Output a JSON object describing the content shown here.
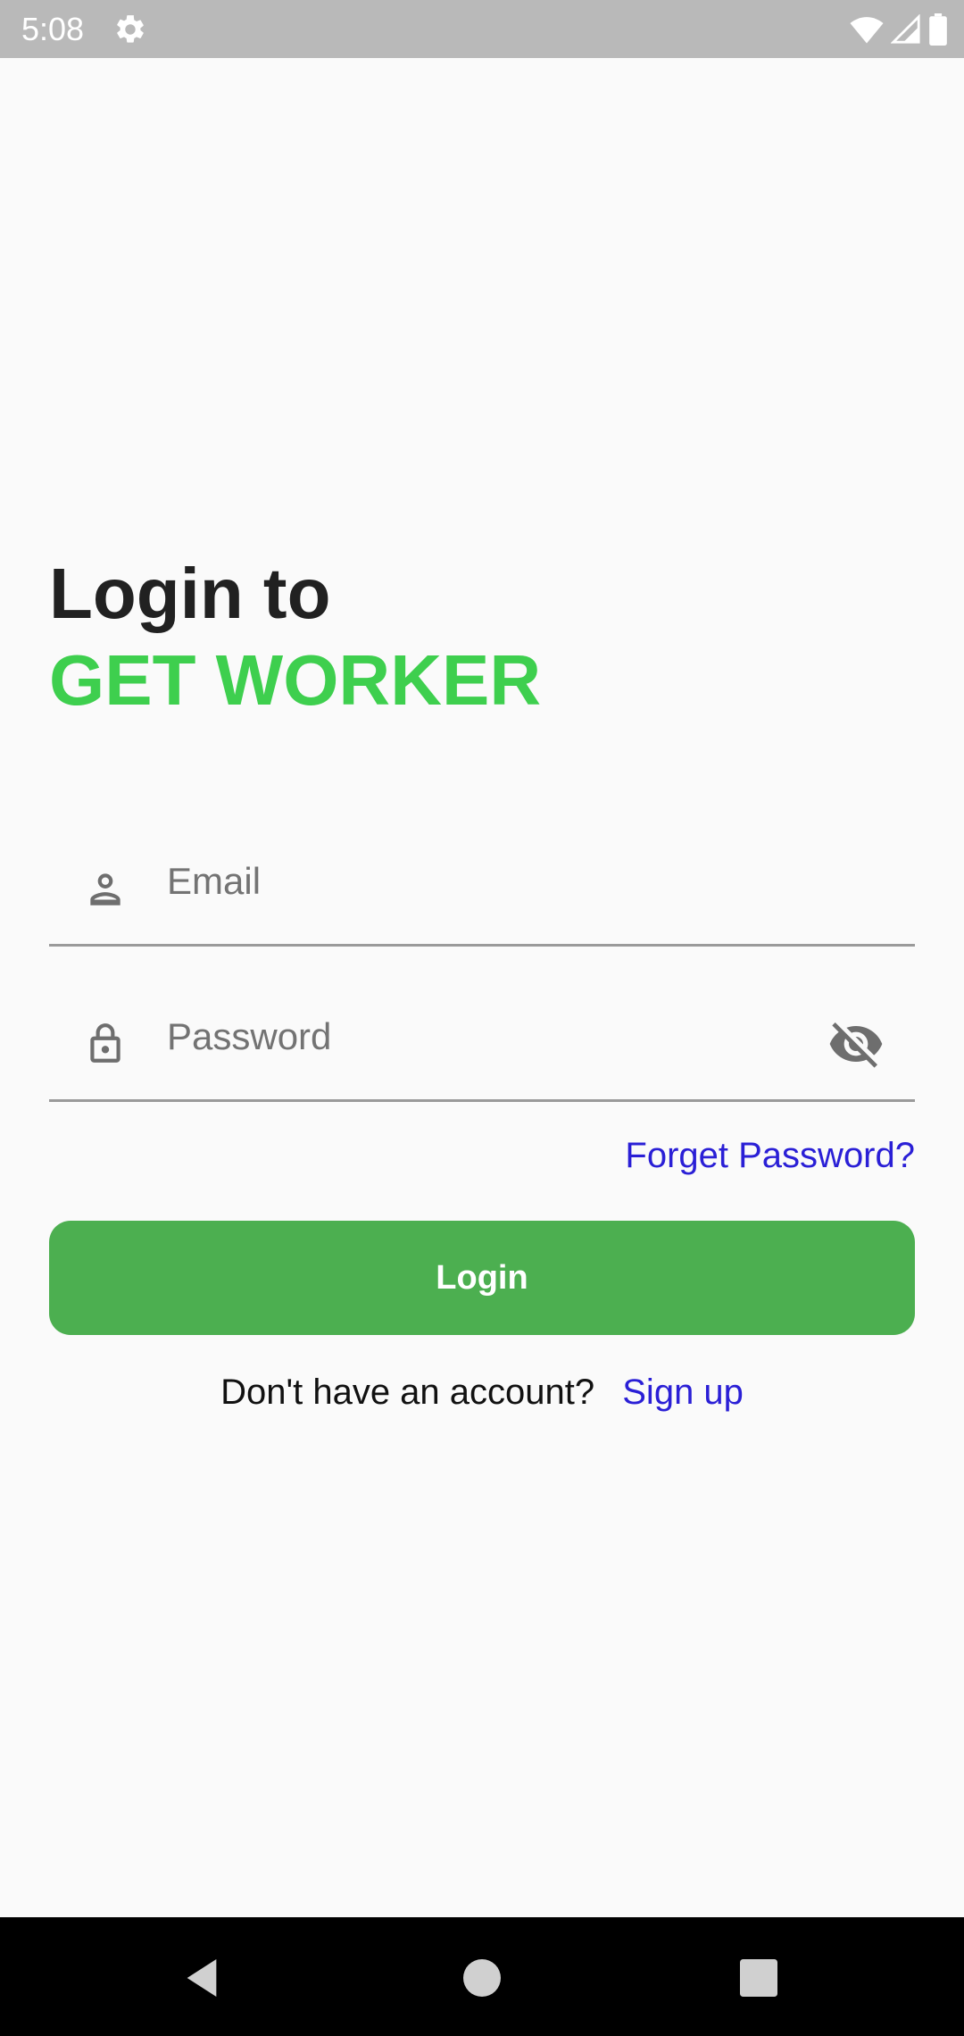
{
  "status_bar": {
    "time": "5:08",
    "icons": [
      "settings-icon",
      "wifi-icon",
      "cell-signal-icon",
      "battery-icon"
    ]
  },
  "title": {
    "line1": "Login to",
    "line2": "GET WORKER"
  },
  "email_field": {
    "placeholder": "Email",
    "value": "",
    "icon": "person-icon"
  },
  "password_field": {
    "placeholder": "Password",
    "value": "",
    "icon": "lock-icon",
    "toggle_icon": "visibility-off-icon"
  },
  "forgot_password": "Forget Password?",
  "login_button": "Login",
  "signup": {
    "prompt": "Don't have an account?",
    "link": "Sign up"
  },
  "nav_bar": {
    "icons": [
      "back-icon",
      "home-icon",
      "recents-icon"
    ]
  },
  "colors": {
    "accent_green": "#3ecf4e",
    "button_green": "#4caf50",
    "link_blue": "#2a1fd6",
    "background": "#fafafa",
    "status_bar": "#b9b9b9"
  }
}
